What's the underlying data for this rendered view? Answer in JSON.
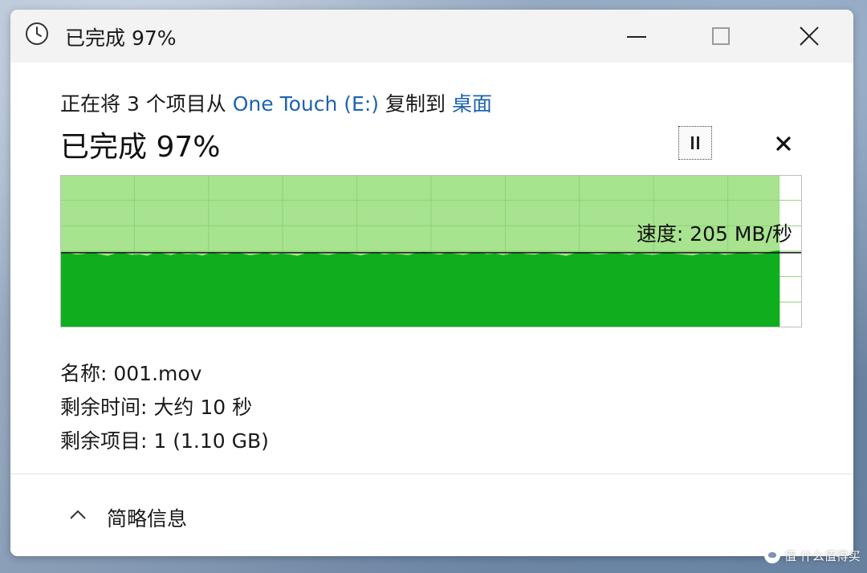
{
  "window": {
    "title": "已完成 97%"
  },
  "controls": {
    "minimize_icon": "minimize-icon",
    "maximize_icon": "maximize-icon",
    "close_icon": "close-icon"
  },
  "copy": {
    "prefix": "正在将 3 个项目从 ",
    "source": "One Touch (E:)",
    "middle": " 复制到 ",
    "destination": "桌面"
  },
  "progress": {
    "label": "已完成 97%",
    "percent": 97
  },
  "speed": {
    "label": "速度: 205 MB/秒"
  },
  "chart_data": {
    "type": "area",
    "progress_fraction": 0.97,
    "current_speed_fraction": 0.49,
    "speed_history": [
      0.485,
      0.49,
      0.478,
      0.482,
      0.495,
      0.48,
      0.47,
      0.486,
      0.49,
      0.476,
      0.48,
      0.47,
      0.492,
      0.485,
      0.474,
      0.488,
      0.479,
      0.483,
      0.471,
      0.49,
      0.484,
      0.478,
      0.492,
      0.486,
      0.473,
      0.481,
      0.49,
      0.476,
      0.485,
      0.479,
      0.47,
      0.487,
      0.493,
      0.48,
      0.475,
      0.486,
      0.49,
      0.482,
      0.472,
      0.484,
      0.491,
      0.478,
      0.486,
      0.48,
      0.474,
      0.489,
      0.496,
      0.485,
      0.478,
      0.49,
      0.483,
      0.476,
      0.487,
      0.492,
      0.48,
      0.486,
      0.474,
      0.485,
      0.49,
      0.481,
      0.477,
      0.488,
      0.484,
      0.479,
      0.47,
      0.486,
      0.492,
      0.485,
      0.478,
      0.482,
      0.49,
      0.484,
      0.476,
      0.487,
      0.481,
      0.475,
      0.486,
      0.49,
      0.483,
      0.478,
      0.472,
      0.485,
      0.48,
      0.488,
      0.476,
      0.482,
      0.49,
      0.486,
      0.479,
      0.484,
      0.5,
      0.506
    ],
    "grid": true,
    "colors": {
      "filled_background": "#a8e38f",
      "area": "#0fae1f",
      "grid_line": "#8fd27a",
      "speed_line": "#111111",
      "border": "#bdbdbd"
    }
  },
  "details": {
    "name_label": "名称: 001.mov",
    "time_label": "剩余时间: 大约 10 秒",
    "items_label": "剩余项目: 1 (1.10 GB)"
  },
  "footer": {
    "toggle_label": "简略信息"
  },
  "watermark": {
    "text": "值 什么值得买"
  },
  "colors": {
    "link": "#1e63b0",
    "titlebar": "#f3f3f3"
  }
}
